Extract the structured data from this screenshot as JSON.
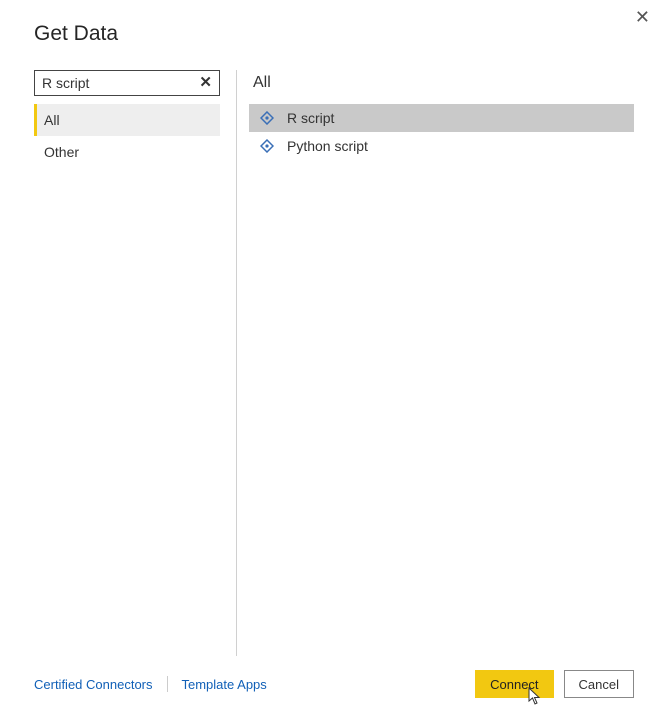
{
  "dialog": {
    "title": "Get Data",
    "close_glyph": "✕"
  },
  "search": {
    "value": "R script",
    "clear_glyph": "✕"
  },
  "categories": {
    "items": [
      {
        "label": "All",
        "selected": true
      },
      {
        "label": "Other",
        "selected": false
      }
    ]
  },
  "connectors": {
    "header": "All",
    "items": [
      {
        "label": "R script",
        "selected": true
      },
      {
        "label": "Python script",
        "selected": false
      }
    ]
  },
  "footer": {
    "links": {
      "certified": "Certified Connectors",
      "template": "Template Apps"
    },
    "connect_label": "Connect",
    "cancel_label": "Cancel"
  },
  "colors": {
    "accent": "#f2c811",
    "link": "#1160b7"
  }
}
